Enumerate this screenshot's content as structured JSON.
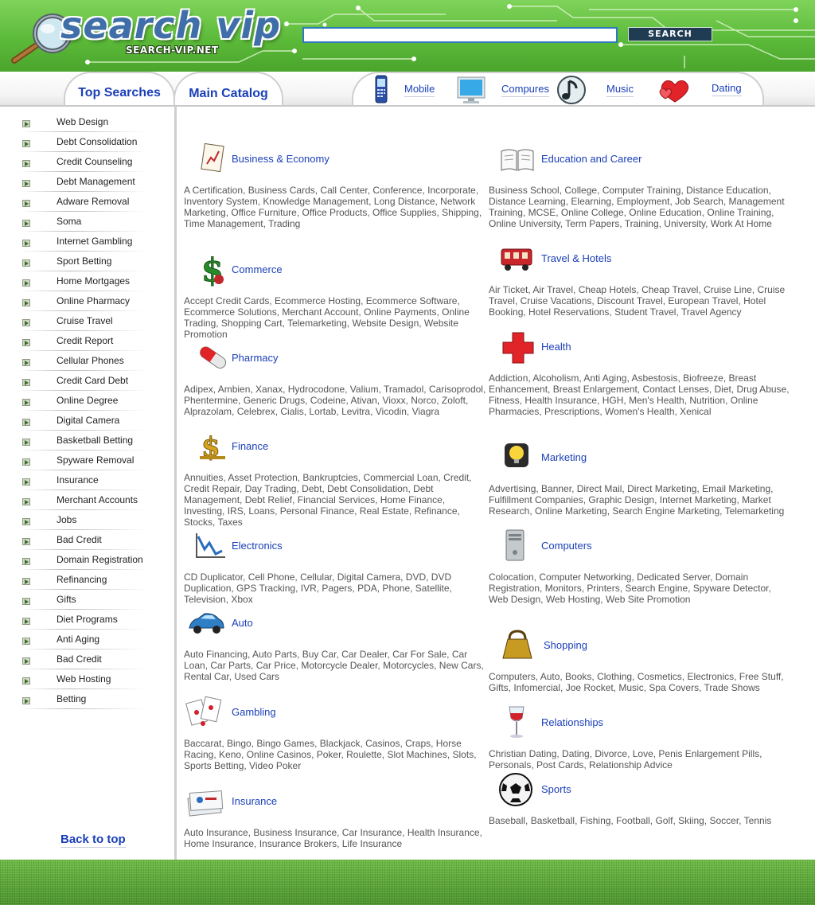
{
  "brand": {
    "title": "search vip",
    "subtitle": "SEARCH-VIP.NET"
  },
  "search": {
    "value": "",
    "button_label": "SEARCH"
  },
  "tabs": {
    "top_searches": "Top Searches",
    "main_catalog": "Main Catalog"
  },
  "quick_links": [
    {
      "label": "Mobile",
      "icon": "mobile-phone-icon"
    },
    {
      "label": "Compures",
      "icon": "monitor-icon"
    },
    {
      "label": "Music",
      "icon": "music-note-icon"
    },
    {
      "label": "Dating",
      "icon": "hearts-icon"
    }
  ],
  "sidebar": {
    "items": [
      "Web Design",
      "Debt Consolidation",
      "Credit Counseling",
      "Debt Management",
      "Adware Removal",
      "Soma",
      "Internet Gambling",
      "Sport Betting",
      "Home Mortgages",
      "Online Pharmacy",
      "Cruise Travel",
      "Credit Report",
      "Cellular Phones",
      "Credit Card Debt",
      "Online Degree",
      "Digital Camera",
      "Basketball Betting",
      "Spyware Removal",
      "Insurance",
      "Merchant Accounts",
      "Jobs",
      "Bad Credit",
      "Domain Registration",
      "Refinancing",
      "Gifts",
      "Diet Programs",
      "Anti Aging",
      "Bad Credit",
      "Web Hosting",
      "Betting"
    ],
    "back_to_top": "Back to top"
  },
  "catalog": {
    "left": [
      {
        "title": "Business & Economy",
        "icon": "chart-document-icon",
        "desc": "A Certification, Business Cards, Call Center, Conference, Incorporate, Inventory System, Knowledge Management, Long Distance, Network Marketing, Office Furniture, Office Products, Office Supplies, Shipping, Time Management, Trading"
      },
      {
        "title": "Commerce",
        "icon": "dollar-sign-icon",
        "desc": "Accept Credit Cards, Ecommerce Hosting, Ecommerce Software, Ecommerce Solutions, Merchant Account, Online Payments, Online Trading, Shopping Cart, Telemarketing, Website Design, Website Promotion"
      },
      {
        "title": "Pharmacy",
        "icon": "pill-icon",
        "desc": "Adipex, Ambien, Xanax, Hydrocodone, Valium, Tramadol, Carisoprodol, Phentermine, Generic Drugs, Codeine, Ativan, Vioxx, Norco, Zoloft, Alprazolam, Celebrex, Cialis, Lortab, Levitra, Vicodin, Viagra"
      },
      {
        "title": "Finance",
        "icon": "gold-dollar-icon",
        "desc": "Annuities, Asset Protection, Bankruptcies, Commercial Loan, Credit, Credit Repair, Day Trading, Debt, Debt Consolidation, Debt Management, Debt Relief, Financial Services, Home Finance, Investing, IRS, Loans, Personal Finance, Real Estate, Refinance, Stocks, Taxes"
      },
      {
        "title": "Electronics",
        "icon": "electronics-chart-icon",
        "desc": "CD Duplicator, Cell Phone, Cellular, Digital Camera, DVD, DVD Duplication, GPS Tracking, IVR, Pagers, PDA, Phone, Satellite, Television, Xbox"
      },
      {
        "title": "Auto",
        "icon": "car-icon",
        "desc": "Auto Financing, Auto Parts, Buy Car, Car Dealer, Car For Sale, Car Loan, Car Parts, Car Price, Motorcycle Dealer, Motorcycles, New Cars, Rental Car, Used Cars"
      },
      {
        "title": "Gambling",
        "icon": "playing-cards-icon",
        "desc": "Baccarat, Bingo, Bingo Games, Blackjack, Casinos, Craps, Horse Racing, Keno, Online Casinos, Poker, Roulette, Slot Machines, Slots, Sports Betting, Video Poker"
      },
      {
        "title": "Insurance",
        "icon": "insurance-cards-icon",
        "desc": "Auto Insurance, Business Insurance, Car Insurance, Health Insurance, Home Insurance, Insurance Brokers, Life Insurance"
      }
    ],
    "right": [
      {
        "title": "Education and Career",
        "icon": "open-book-icon",
        "desc": "Business School, College, Computer Training, Distance Education, Distance Learning, Elearning, Employment, Job Search, Management Training, MCSE, Online College, Online Education, Online Training, Online University, Term Papers, Training, University, Work At Home"
      },
      {
        "title": "Travel & Hotels",
        "icon": "trolley-car-icon",
        "desc": "Air Ticket, Air Travel, Cheap Hotels, Cheap Travel, Cruise Line, Cruise Travel, Cruise Vacations, Discount Travel, European Travel, Hotel Booking, Hotel Reservations, Student Travel, Travel Agency"
      },
      {
        "title": "Health",
        "icon": "red-cross-icon",
        "desc": "Addiction, Alcoholism, Anti Aging, Asbestosis, Biofreeze, Breast Enhancement, Breast Enlargement, Contact Lenses, Diet, Drug Abuse, Fitness, Health Insurance, HGH, Men's Health, Nutrition, Online Pharmacies, Prescriptions, Women's Health, Xenical"
      },
      {
        "title": "Marketing",
        "icon": "lightbulb-icon",
        "desc": "Advertising, Banner, Direct Mail, Direct Marketing, Email Marketing, Fulfillment Companies, Graphic Design, Internet Marketing, Market Research, Online Marketing, Search Engine Marketing, Telemarketing"
      },
      {
        "title": "Computers",
        "icon": "computer-tower-icon",
        "desc": "Colocation, Computer Networking, Dedicated Server, Domain Registration, Monitors, Printers, Search Engine, Spyware Detector, Web Design, Web Hosting, Web Site Promotion"
      },
      {
        "title": "Shopping",
        "icon": "shopping-bag-icon",
        "desc": "Computers, Auto, Books, Clothing, Cosmetics, Electronics, Free Stuff, Gifts, Infomercial, Joe Rocket, Music, Spa Covers, Trade Shows"
      },
      {
        "title": "Relationships",
        "icon": "wine-glass-icon",
        "desc": "Christian Dating, Dating, Divorce, Love, Penis Enlargement Pills, Personals, Post Cards, Relationship Advice"
      },
      {
        "title": "Sports",
        "icon": "soccer-ball-icon",
        "desc": "Baseball, Basketball, Fishing, Football, Golf, Skiing, Soccer, Tennis"
      }
    ]
  }
}
